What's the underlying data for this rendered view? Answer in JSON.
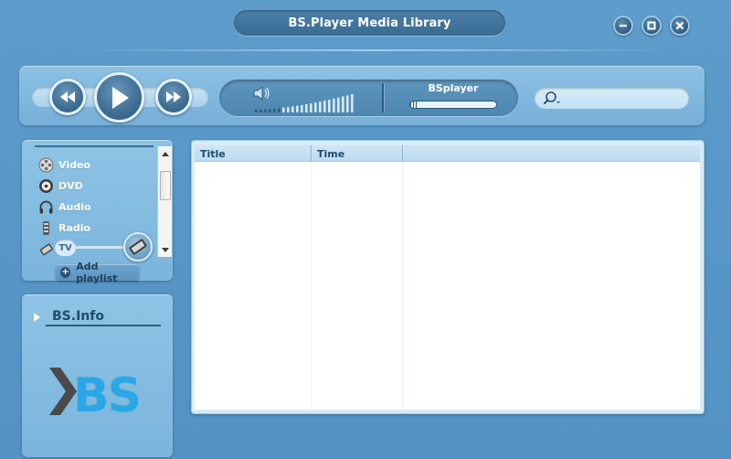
{
  "window": {
    "title": "BS.Player Media Library",
    "controls": [
      "minimize-icon",
      "maximize-icon",
      "close-icon"
    ]
  },
  "transport": {
    "buttons": [
      "rewind-icon",
      "play-icon",
      "fast-forward-icon"
    ]
  },
  "status": {
    "player_name": "BSplayer",
    "volume_icon": "speaker-icon",
    "progress": 0.1
  },
  "search": {
    "value": "",
    "placeholder": ""
  },
  "sidebar": {
    "categories": [
      {
        "label": "Video",
        "icon": "film-reel-icon"
      },
      {
        "label": "DVD",
        "icon": "disc-icon"
      },
      {
        "label": "Audio",
        "icon": "headphones-icon"
      },
      {
        "label": "Radio",
        "icon": "radio-icon"
      },
      {
        "label": "TV",
        "icon": "tv-icon"
      }
    ],
    "add_playlist_label": "Add playlist"
  },
  "info": {
    "title": "BS.Info",
    "logo_text": "BS"
  },
  "list": {
    "columns": [
      "Title",
      "Time"
    ],
    "rows": []
  },
  "colors": {
    "background": "#5897c8",
    "panel": "#8ec3e5",
    "accent_dark": "#2d5b7e",
    "logo_blue": "#2aa7e6",
    "logo_gray": "#4a4a4a"
  }
}
